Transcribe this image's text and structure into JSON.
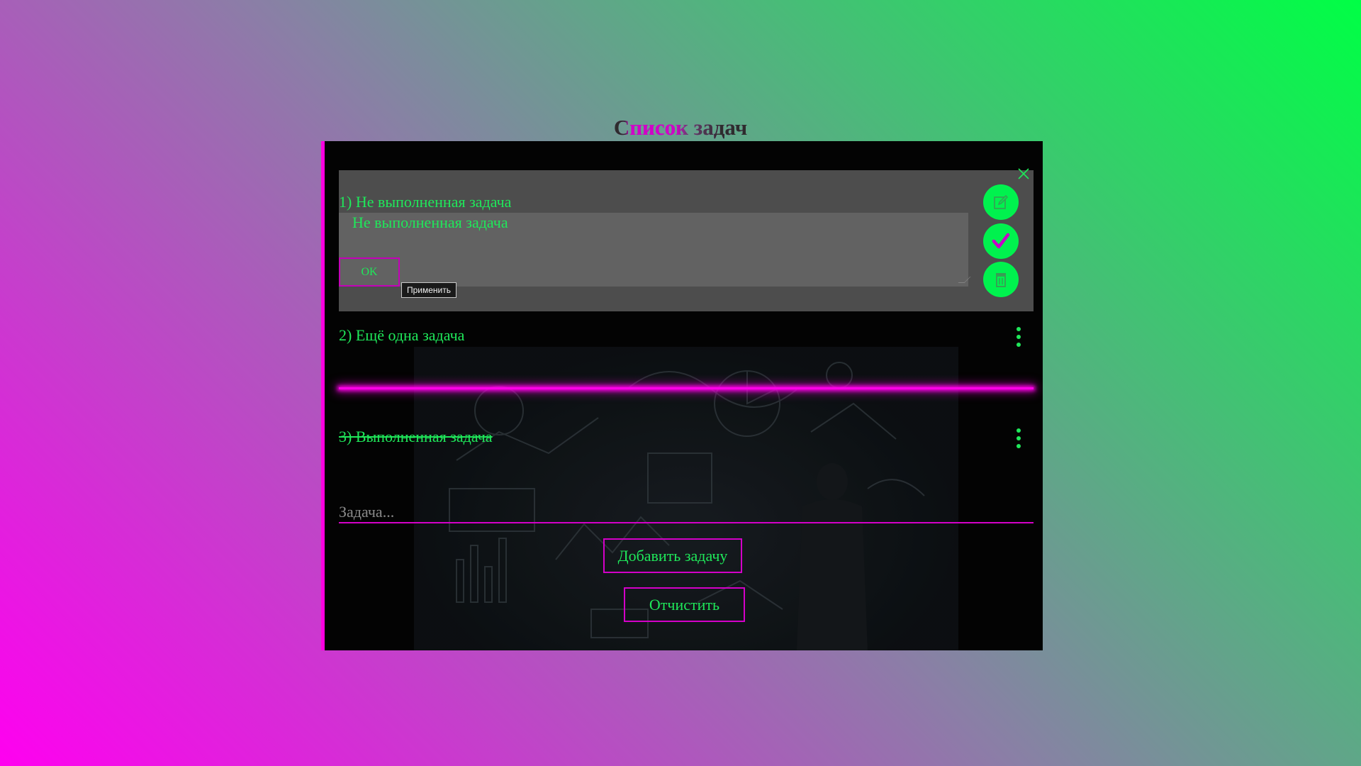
{
  "page": {
    "title": "Список задач",
    "title_parts": [
      "С",
      "писок",
      " задач"
    ]
  },
  "tasks": [
    {
      "number_text": "1) Не выполненная задача",
      "state": "editing",
      "edit_value": "Не выполненная задача",
      "ok_label": "OK",
      "ok_tooltip": "Применить",
      "actions": [
        "edit-icon",
        "check-icon",
        "trash-icon"
      ]
    },
    {
      "number_text": "2) Ещё одна задача",
      "state": "active",
      "menu_icon": "vertical-dots-icon"
    },
    {
      "number_text": "3) Выполненная задача",
      "state": "completed",
      "menu_icon": "vertical-dots-icon"
    }
  ],
  "new_task": {
    "placeholder": "Задача..."
  },
  "buttons": {
    "add_label": "Добавить задачу",
    "clear_label": "Отчистить"
  },
  "colors": {
    "accent_green": "#1fe85a",
    "accent_pink": "#ff00e8",
    "panel_bg": "#030303",
    "edit_bg": "#4d4d4d"
  }
}
